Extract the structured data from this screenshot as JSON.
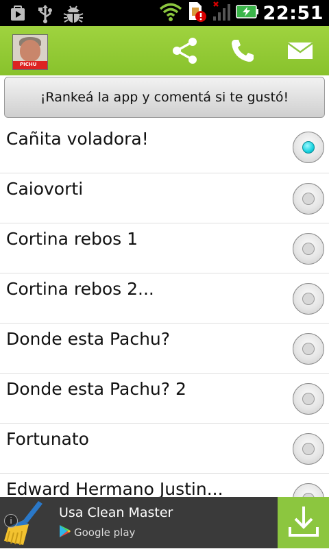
{
  "status_bar": {
    "time": "22:51",
    "left_icons": [
      "play-store-icon",
      "usb-icon",
      "bug-icon"
    ],
    "right_icons": [
      "wifi-icon",
      "sim-alert-icon",
      "signal-icon",
      "battery-charging-icon"
    ]
  },
  "action_bar": {
    "avatar_tag": "PICHU",
    "icons": [
      "share-icon",
      "phone-icon",
      "mail-icon"
    ],
    "color": "#8cc63f"
  },
  "rate_button": {
    "label": "¡Rankeá la app y comentá si te gustó!"
  },
  "list": {
    "items": [
      {
        "label": "Cañita voladora!",
        "selected": true
      },
      {
        "label": "Caiovorti",
        "selected": false
      },
      {
        "label": "Cortina rebos 1",
        "selected": false
      },
      {
        "label": "Cortina rebos 2...",
        "selected": false
      },
      {
        "label": "Donde esta Pachu?",
        "selected": false
      },
      {
        "label": "Donde esta Pachu? 2",
        "selected": false
      },
      {
        "label": "Fortunato",
        "selected": false
      },
      {
        "label": "Edward Hermano Justin...",
        "selected": false
      }
    ],
    "accent": "#18d3e0"
  },
  "ad": {
    "title": "Usa Clean Master",
    "store": "Google play",
    "icons": [
      "broom-icon",
      "download-icon",
      "info-icon"
    ]
  }
}
